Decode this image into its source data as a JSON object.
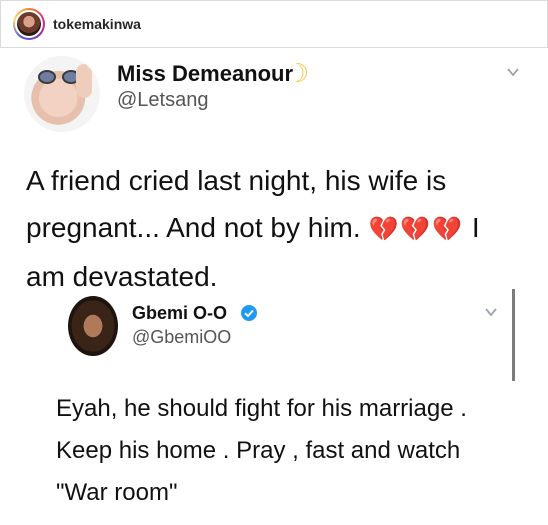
{
  "instagram": {
    "username": "tokemakinwa"
  },
  "tweet": {
    "display_name": "Miss Demeanour",
    "handle": "@Letsang",
    "line1": "A friend cried last night, his wife is",
    "line2": "pregnant... And not by him.",
    "line2_tail": "I",
    "line3": "am devastated.",
    "broken_hearts": "💔💔💔"
  },
  "quoted_tweet": {
    "display_name": "Gbemi O-O",
    "handle": "@GbemiOO",
    "line1": "Eyah, he should fight for his marriage .",
    "line2": "Keep his home . Pray , fast and watch",
    "line3": "\"War room\""
  },
  "icons": {
    "badge_name": "crescent-icon",
    "verified_color": "#1d9bf0"
  }
}
